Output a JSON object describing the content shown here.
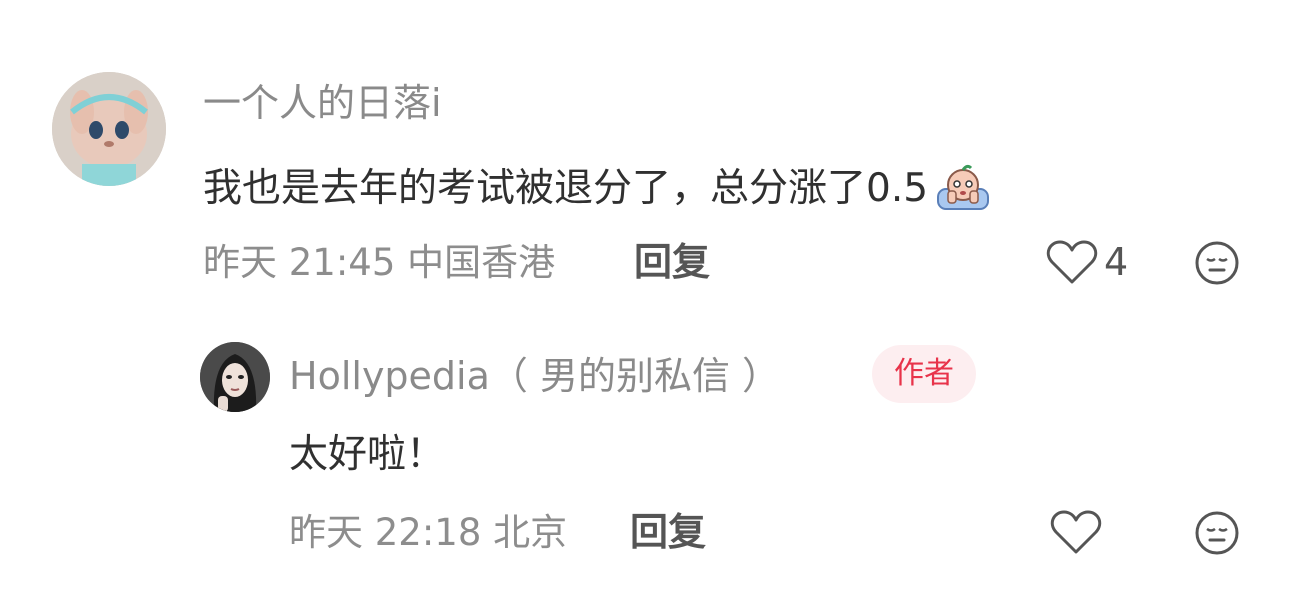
{
  "comments": [
    {
      "author": "一个人的日落i",
      "text": "我也是去年的考试被退分了，总分涨了0.5",
      "meta": "昨天 21:45 中国香港",
      "reply_label": "回复",
      "like_count": "4",
      "emoji_icon": "crying-baby-sticker-icon"
    }
  ],
  "reply": {
    "author": "Hollypedia（ 男的别私信 ）",
    "badge": "作者",
    "text": "太好啦！",
    "meta": "昨天 22:18 北京",
    "reply_label": "回复"
  },
  "icons": {
    "like": "heart-icon",
    "dislike": "neutral-face-icon"
  },
  "colors": {
    "badge_bg": "#fdeef0",
    "badge_text": "#e8334a"
  }
}
